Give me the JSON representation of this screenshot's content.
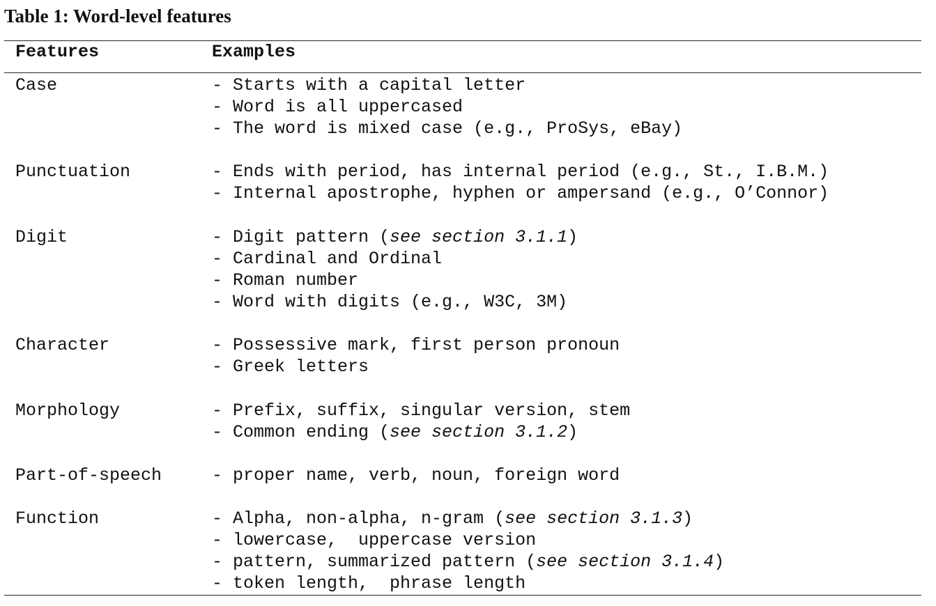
{
  "caption": "Table 1: Word-level features",
  "headers": {
    "features": "Features",
    "examples": "Examples"
  },
  "rows": [
    {
      "feature": "Case",
      "examples": [
        [
          {
            "t": "- Starts with a capital letter"
          }
        ],
        [
          {
            "t": "- Word is all uppercased"
          }
        ],
        [
          {
            "t": "- The word is mixed case (e.g., ProSys, eBay)"
          }
        ]
      ]
    },
    {
      "feature": "Punctuation",
      "examples": [
        [
          {
            "t": "- Ends with period, has internal period (e.g., St., I.B.M.)"
          }
        ],
        [
          {
            "t": "- Internal apostrophe, hyphen or ampersand (e.g., O’Connor)"
          }
        ]
      ]
    },
    {
      "feature": "Digit",
      "examples": [
        [
          {
            "t": "- Digit pattern ("
          },
          {
            "t": "see section 3.1.1",
            "i": true
          },
          {
            "t": ")"
          }
        ],
        [
          {
            "t": "- Cardinal and Ordinal"
          }
        ],
        [
          {
            "t": "- Roman number"
          }
        ],
        [
          {
            "t": "- Word with digits (e.g., W3C, 3M)"
          }
        ]
      ]
    },
    {
      "feature": "Character",
      "examples": [
        [
          {
            "t": "- Possessive mark, first person pronoun"
          }
        ],
        [
          {
            "t": "- Greek letters"
          }
        ]
      ]
    },
    {
      "feature": "Morphology",
      "examples": [
        [
          {
            "t": "- Prefix, suffix, singular version, stem"
          }
        ],
        [
          {
            "t": "- Common ending ("
          },
          {
            "t": "see section 3.1.2",
            "i": true
          },
          {
            "t": ")"
          }
        ]
      ]
    },
    {
      "feature": "Part-of-speech",
      "examples": [
        [
          {
            "t": "- proper name, verb, noun, foreign word"
          }
        ]
      ]
    },
    {
      "feature": "Function",
      "examples": [
        [
          {
            "t": "- Alpha, non-alpha, n-gram ("
          },
          {
            "t": "see section 3.1.3",
            "i": true
          },
          {
            "t": ")"
          }
        ],
        [
          {
            "t": "- lowercase,  uppercase version"
          }
        ],
        [
          {
            "t": "- pattern, summarized pattern ("
          },
          {
            "t": "see section 3.1.4",
            "i": true
          },
          {
            "t": ")"
          }
        ],
        [
          {
            "t": "- token length,  phrase length"
          }
        ]
      ]
    }
  ]
}
